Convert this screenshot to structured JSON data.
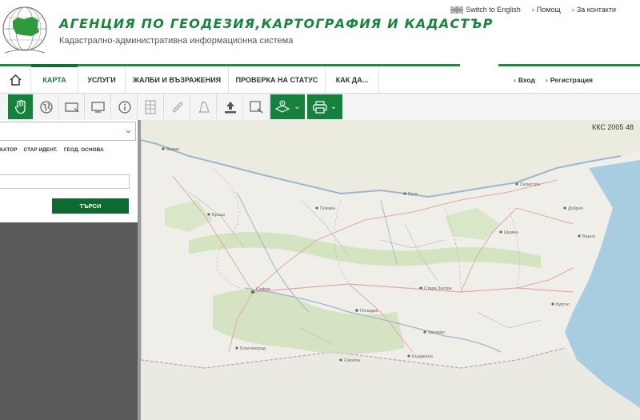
{
  "header": {
    "agency_title": "АГЕНЦИЯ ПО ГЕОДЕЗИЯ,КАРТОГРАФИЯ И КАДАСТЪР",
    "agency_subtitle": "Кадастрално-административна информационна система",
    "links": {
      "english": "Switch to English",
      "help": "Помощ",
      "contacts": "За контакти"
    }
  },
  "nav": {
    "items": [
      "КАРТА",
      "УСЛУГИ",
      "ЖАЛБИ И ВЪЗРАЖЕНИЯ",
      "ПРОВЕРКА НА СТАТУС",
      "КАК ДА..."
    ],
    "active_index": 0,
    "login": "Вход",
    "register": "Регистрация"
  },
  "toolbar": {
    "tools": [
      "pan-hand-icon",
      "globe-icon",
      "rectangle-select-icon",
      "monitor-icon",
      "info-icon",
      "grid-measure-icon",
      "ruler-icon",
      "polygon-icon",
      "upload-icon",
      "zoom-box-icon"
    ],
    "dropdowns": [
      "layers-download-icon",
      "print-icon"
    ]
  },
  "search_panel": {
    "select_value": "",
    "tabs": [
      "КАТОР",
      "СТАР ИДЕНТ.",
      "ГЕОД. ОСНОВА"
    ],
    "input_value": "",
    "search_button": "ТЪРСИ"
  },
  "map": {
    "crs_label": "ККС 2005 48",
    "place_labels": [
      "Видин",
      "Враца",
      "Плевен",
      "Русе",
      "Силистра",
      "Добрич",
      "Варна",
      "Шумен",
      "Бургас",
      "София",
      "Пловдив",
      "Стара Загора",
      "Хасково",
      "Кърджали",
      "Благоевград",
      "Смолян"
    ]
  },
  "colors": {
    "brand_green": "#13883b",
    "dark_green": "#0e6b30",
    "panel_grey": "#5a5a5a",
    "sea_blue": "#a9cde0"
  }
}
